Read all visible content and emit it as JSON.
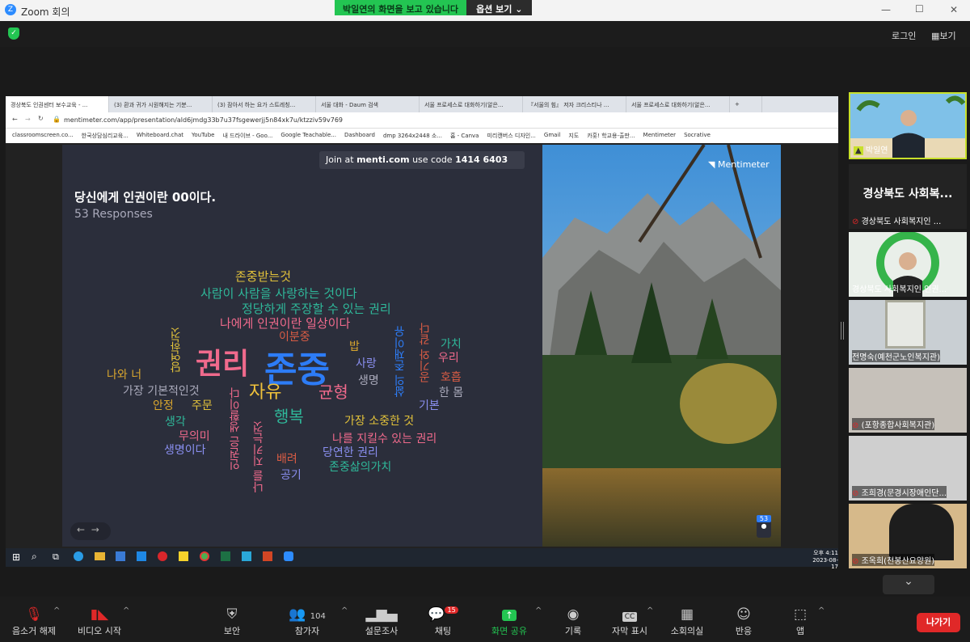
{
  "window": {
    "title": "Zoom 회의",
    "min": "—",
    "max": "☐",
    "close": "✕"
  },
  "share_banner": {
    "status": "박일연의 화면을 보고 있습니다",
    "options": "옵션 보기"
  },
  "top": {
    "login": "로그인",
    "view": "보기"
  },
  "browser": {
    "tabs": [
      "경상북도 인권센터 보수교육 - ...",
      "(3) 환과 귀가 시원해지는 기분...",
      "(3) 잠아서 하는 요가 스트레칭...",
      "서울 대화 - Daum 검색",
      "서울 프로세스로 대화하기(알은...",
      "『서울의 힘』 저자 크리스티나 ...",
      "서울 프로세스로 대화하기(알은..."
    ],
    "url": "mentimeter.com/app/presentation/ald6jmdg33b7u37fsgewerjj5n84xk7u/ktzziv59v769",
    "bookmarks": [
      "classroomscreen.co...",
      "한국상담심리교육...",
      "Whiteboard.chat",
      "YouTube",
      "내 드라이브 - Goo...",
      "Google Teachable...",
      "Dashboard",
      "dmp 3264x2448 소...",
      "홈 - Canva",
      "미리캔버스 디자인...",
      "Gmail",
      "지도",
      "카훗! 학교용-출판...",
      "Mentimeter",
      "Socrative"
    ]
  },
  "slide": {
    "join": "Join at",
    "site": "menti.com",
    "use_code": "use code",
    "code": "1414 6403",
    "brand": "Mentimeter",
    "question": "당신에게 인권이란 00이다.",
    "responses": "53 Responses",
    "audience_count": "53",
    "words_h": [
      "존중받는것",
      "사람이 사람을 사랑하는 것이다",
      "정당하게 주장할 수 있는 권리",
      "나에게 인권이란 일상이다",
      "이분중",
      "권리",
      "존중",
      "밥",
      "사랑",
      "가치",
      "우리",
      "나와 너",
      "가장 기본적인것",
      "생명",
      "호흡",
      "자유",
      "균형",
      "안정",
      "주문",
      "한 몸",
      "기본",
      "행복",
      "생각",
      "가장 소중한 것",
      "무의미",
      "나를 지킬수 있는 권리",
      "생명이다",
      "당연한 권리",
      "배려",
      "존중삶의가치",
      "공기"
    ],
    "words_v": [
      "당연한것",
      "인권은 생활이다",
      "나를 지키는것",
      "삶의 존재이유",
      "공기와 같다"
    ]
  },
  "taskbar": {
    "time": "오후 4:11",
    "date": "2023-08-17"
  },
  "participants": [
    {
      "name": "박일연",
      "type": "video"
    },
    {
      "name": "경상북도 사회복...",
      "sub": "경상북도 사회복지인 ...",
      "type": "name"
    },
    {
      "name": "경상북도 사회복지인 인권...",
      "type": "video"
    },
    {
      "name": "전명숙(예천군노인복지관)",
      "type": "video"
    },
    {
      "name": "(포항종합사회복지관)",
      "type": "video"
    },
    {
      "name": "조희경(문경시장애인단...",
      "type": "video"
    },
    {
      "name": "조옥희(천봉산요양원)",
      "type": "video"
    }
  ],
  "toolbar": {
    "mute": "음소거 해제",
    "video": "비디오 시작",
    "security": "보안",
    "participants": "참가자",
    "participants_count": "104",
    "poll": "설문조사",
    "chat": "채팅",
    "chat_badge": "15",
    "share": "화면 공유",
    "record": "기록",
    "captions": "자막 표시",
    "breakout": "소회의실",
    "reactions": "반응",
    "apps": "앱",
    "leave": "나가기"
  },
  "colors": {
    "accent_green": "#23c552",
    "leave": "#e02828",
    "menti_bg": "#2b2e3b"
  }
}
